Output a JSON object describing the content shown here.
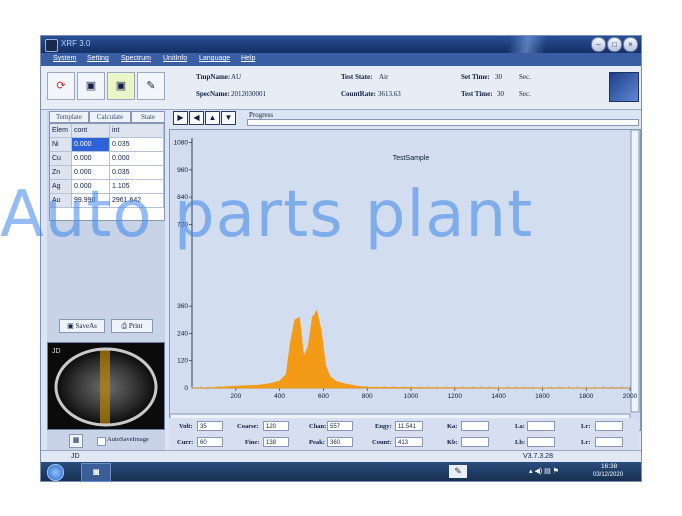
{
  "app": {
    "title": "XRF 3.0"
  },
  "menu": [
    "System",
    "Setting",
    "Spectrum",
    "UnitInfo",
    "Language",
    "Help"
  ],
  "toolbar": {
    "tmp_name_label": "TmpName:",
    "tmp_name": "AU",
    "spec_name_label": "SpecName:",
    "spec_name": "2012030001",
    "test_state_label": "Test State:",
    "test_state": "Air",
    "count_rate_label": "CountRate:",
    "count_rate": "3613.63",
    "set_time_label": "Set Time:",
    "set_time": "30",
    "set_time_unit": "Sec.",
    "test_time_label": "Test Time:",
    "test_time": "30",
    "test_time_unit": "Sec."
  },
  "left_panel": {
    "tabs": [
      "Template",
      "Calculate",
      "State"
    ],
    "headers": [
      "Elem",
      "cont",
      "int"
    ],
    "rows": [
      {
        "elem": "Ni",
        "cont": "0.000",
        "int": "0.035"
      },
      {
        "elem": "Cu",
        "cont": "0.000",
        "int": "0.000"
      },
      {
        "elem": "Zn",
        "cont": "0.000",
        "int": "0.035"
      },
      {
        "elem": "Ag",
        "cont": "0.000",
        "int": "1.105"
      },
      {
        "elem": "Au",
        "cont": "99.990",
        "int": "2961.642"
      }
    ],
    "save_as": "SaveAs",
    "print": "Print",
    "camera_label": "JD",
    "auto_save": "AutoSaveImage"
  },
  "spectrum": {
    "progress_label": "Progress",
    "chart_data": {
      "type": "area",
      "title": "TestSample",
      "xlim": [
        0,
        2000
      ],
      "ylim": [
        0,
        1100
      ],
      "x_ticks": [
        200,
        400,
        600,
        800,
        1000,
        1200,
        1400,
        1600,
        1800,
        2000
      ],
      "y_ticks": [
        120,
        240,
        360,
        720,
        840,
        960,
        1080
      ],
      "color": "#f39a16",
      "x": [
        0,
        100,
        200,
        300,
        350,
        400,
        430,
        450,
        470,
        490,
        510,
        530,
        550,
        570,
        590,
        610,
        630,
        660,
        700,
        750,
        800,
        1000,
        1500,
        2000
      ],
      "values": [
        0,
        2,
        8,
        12,
        18,
        30,
        60,
        200,
        300,
        310,
        140,
        180,
        310,
        340,
        250,
        100,
        50,
        28,
        18,
        8,
        4,
        2,
        1,
        0
      ]
    }
  },
  "status": {
    "volt_label": "Volt:",
    "volt": "35",
    "curr_label": "Curr:",
    "curr": "60",
    "coarse_label": "Coarse:",
    "coarse": "120",
    "fine_label": "Fine:",
    "fine": "138",
    "chan_label": "Chan:",
    "chan": "557",
    "peak_label": "Peak:",
    "peak": "360",
    "engy_label": "Engy:",
    "engy": "11.541",
    "count_label": "Count:",
    "count": "413",
    "ka_label": "Ka:",
    "kb_label": "Kb:",
    "la_label": "La:",
    "lb_label": "Lb:",
    "lr_label": "Lr:"
  },
  "bottom": {
    "left": "JD",
    "version": "V3.7.3.28"
  },
  "taskbar": {
    "time": "16:38",
    "date": "03/12/2020"
  },
  "watermark": "Auto parts plant"
}
